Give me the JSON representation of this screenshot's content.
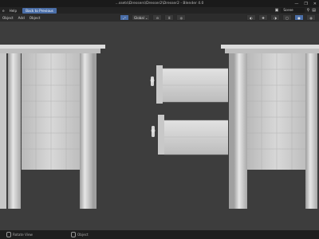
{
  "window": {
    "title": "...ssets\\Dressers\\Dresser2\\Dresser2 - Blender 4.0",
    "controls": [
      "—",
      "❐",
      "✕"
    ]
  },
  "menubar": {
    "items": [
      "e",
      "Help"
    ],
    "workspace_button": "Back to Previous",
    "scene_label": "Scene"
  },
  "header": {
    "items": [
      "Object",
      "Add",
      "Object"
    ],
    "orientation": "Global"
  },
  "status": {
    "left": "Rotate View",
    "right": "Object"
  },
  "colors": {
    "accent": "#4a6ea8",
    "viewport_bg": "#3d3d3d",
    "furniture": "#cfcfcf"
  }
}
